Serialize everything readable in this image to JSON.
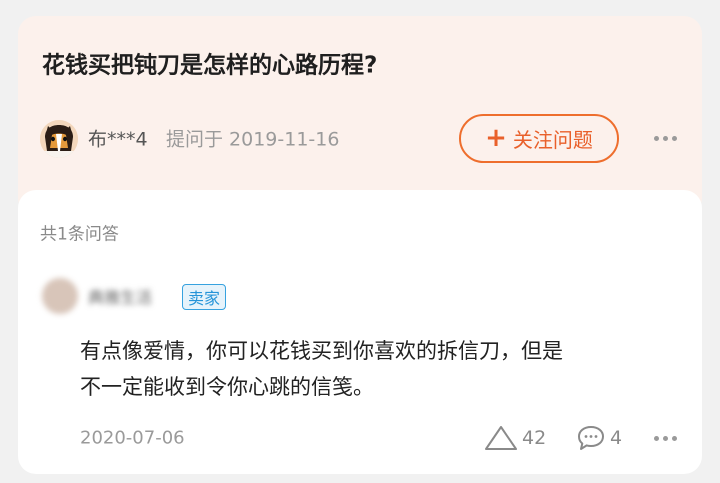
{
  "question": {
    "title": "花钱买把钝刀是怎样的心路历程?",
    "asker_name": "布***4",
    "asked_meta": "提问于 2019-11-16",
    "follow_label": "关注问题",
    "follow_icon": "plus-icon",
    "more_icon": "more-dots-icon"
  },
  "answers": {
    "count_label": "共1条问答",
    "items": [
      {
        "author_name": "典雅生活",
        "badge": "卖家",
        "text_line1": "有点像爱情，你可以花钱买到你喜欢的拆信刀，但是",
        "text_line2": "不一定能收到令你心跳的信笺。",
        "date": "2020-07-06",
        "likes": "42",
        "comments": "4"
      }
    ]
  },
  "colors": {
    "accent": "#ee6e2d",
    "badge": "#2594d8",
    "question_bg": "#fcf1ec"
  }
}
